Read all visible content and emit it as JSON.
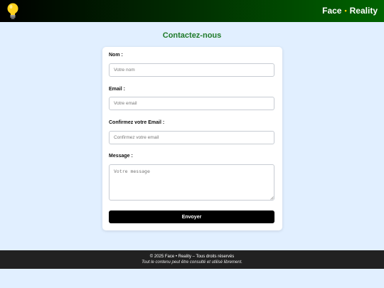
{
  "header": {
    "logo_icon": "lightbulb-icon",
    "brand_left": "Face",
    "brand_separator": "•",
    "brand_right": "Reality",
    "gradient_colors": [
      "#000000",
      "#006400"
    ]
  },
  "main": {
    "title": "Contactez-nous"
  },
  "form": {
    "name_label": "Nom :",
    "name_placeholder": "Votre nom",
    "email_label": "Email :",
    "email_placeholder": "Votre email",
    "confirm_email_label": "Confirmez votre Email :",
    "confirm_email_placeholder": "Confirmez votre email",
    "message_label": "Message :",
    "message_placeholder": "Votre message",
    "submit_label": "Envoyer"
  },
  "footer": {
    "copyright": "© 2025 Face • Reality – Tous droits réservés",
    "note": "Tout le contenu peut être consulté et utilisé librement."
  },
  "colors": {
    "page_background": "#e1efff",
    "title_green": "#1e7a28",
    "submit_background": "#000000",
    "footer_background": "#212121"
  }
}
